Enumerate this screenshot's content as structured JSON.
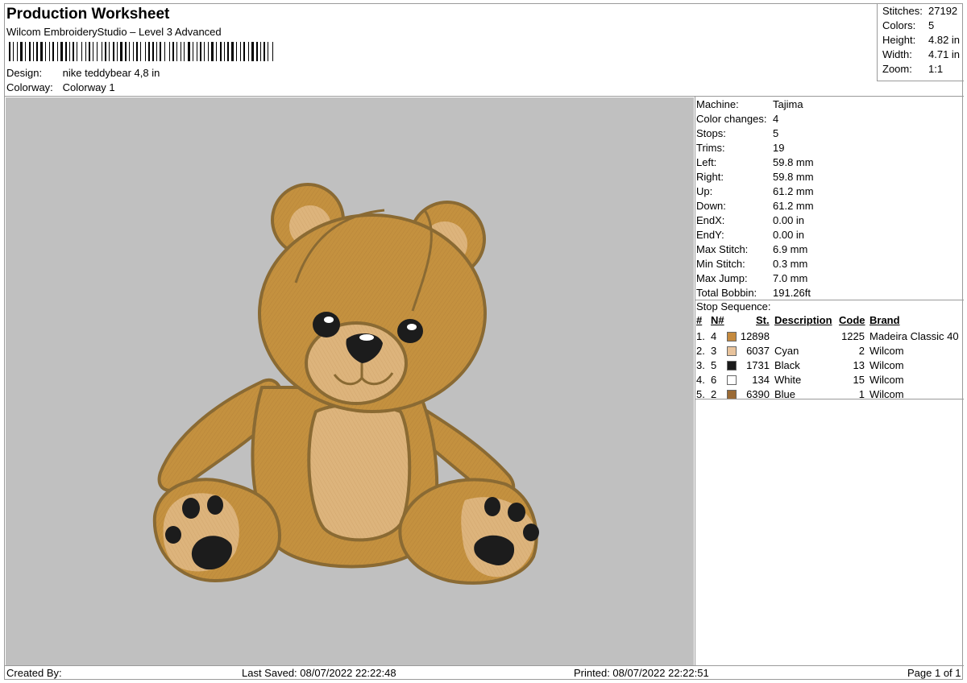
{
  "header": {
    "title": "Production Worksheet",
    "software": "Wilcom EmbroideryStudio – Level 3 Advanced",
    "design_label": "Design:",
    "design_value": "nike teddybear 4,8 in",
    "colorway_label": "Colorway:",
    "colorway_value": "Colorway 1"
  },
  "summary": [
    {
      "label": "Stitches:",
      "value": "27192"
    },
    {
      "label": "Colors:",
      "value": "5"
    },
    {
      "label": "Height:",
      "value": "4.82 in"
    },
    {
      "label": "Width:",
      "value": "4.71 in"
    },
    {
      "label": "Zoom:",
      "value": "1:1"
    }
  ],
  "details": [
    {
      "label": "Machine:",
      "value": "Tajima"
    },
    {
      "label": "Color changes:",
      "value": "4"
    },
    {
      "label": "Stops:",
      "value": "5"
    },
    {
      "label": "Trims:",
      "value": "19"
    },
    {
      "label": "Left:",
      "value": "59.8 mm"
    },
    {
      "label": "Right:",
      "value": "59.8 mm"
    },
    {
      "label": "Up:",
      "value": "61.2 mm"
    },
    {
      "label": "Down:",
      "value": "61.2 mm"
    },
    {
      "label": "EndX:",
      "value": "0.00 in"
    },
    {
      "label": "EndY:",
      "value": "0.00 in"
    },
    {
      "label": "Max Stitch:",
      "value": "6.9 mm"
    },
    {
      "label": "Min Stitch:",
      "value": "0.3 mm"
    },
    {
      "label": "Max Jump:",
      "value": "7.0 mm"
    },
    {
      "label": "Total Bobbin:",
      "value": "191.26ft"
    }
  ],
  "stop_sequence": {
    "label": "Stop Sequence:",
    "columns": {
      "num": "#",
      "needle": "N#",
      "stitches": "St.",
      "description": "Description",
      "code": "Code",
      "brand": "Brand"
    },
    "rows": [
      {
        "num": "1.",
        "needle": "4",
        "color": "#c58a3e",
        "stitches": "12898",
        "description": "",
        "code": "1225",
        "brand": "Madeira Classic 40"
      },
      {
        "num": "2.",
        "needle": "3",
        "color": "#e8c39c",
        "stitches": "6037",
        "description": "Cyan",
        "code": "2",
        "brand": "Wilcom"
      },
      {
        "num": "3.",
        "needle": "5",
        "color": "#1a1a1a",
        "stitches": "1731",
        "description": "Black",
        "code": "13",
        "brand": "Wilcom"
      },
      {
        "num": "4.",
        "needle": "6",
        "color": "#ffffff",
        "stitches": "134",
        "description": "White",
        "code": "15",
        "brand": "Wilcom"
      },
      {
        "num": "5.",
        "needle": "2",
        "color": "#9a6a35",
        "stitches": "6390",
        "description": "Blue",
        "code": "1",
        "brand": "Wilcom"
      }
    ]
  },
  "footer": {
    "created_by": "Created By:",
    "last_saved": "Last Saved: 08/07/2022 22:22:48",
    "printed": "Printed: 08/07/2022 22:22:51",
    "page": "Page 1 of 1"
  },
  "colors": {
    "canvas_bg": "#c0c0c0",
    "bear_body": "#c4913f",
    "bear_light": "#ddb47c",
    "bear_outline": "#8a6a33"
  }
}
